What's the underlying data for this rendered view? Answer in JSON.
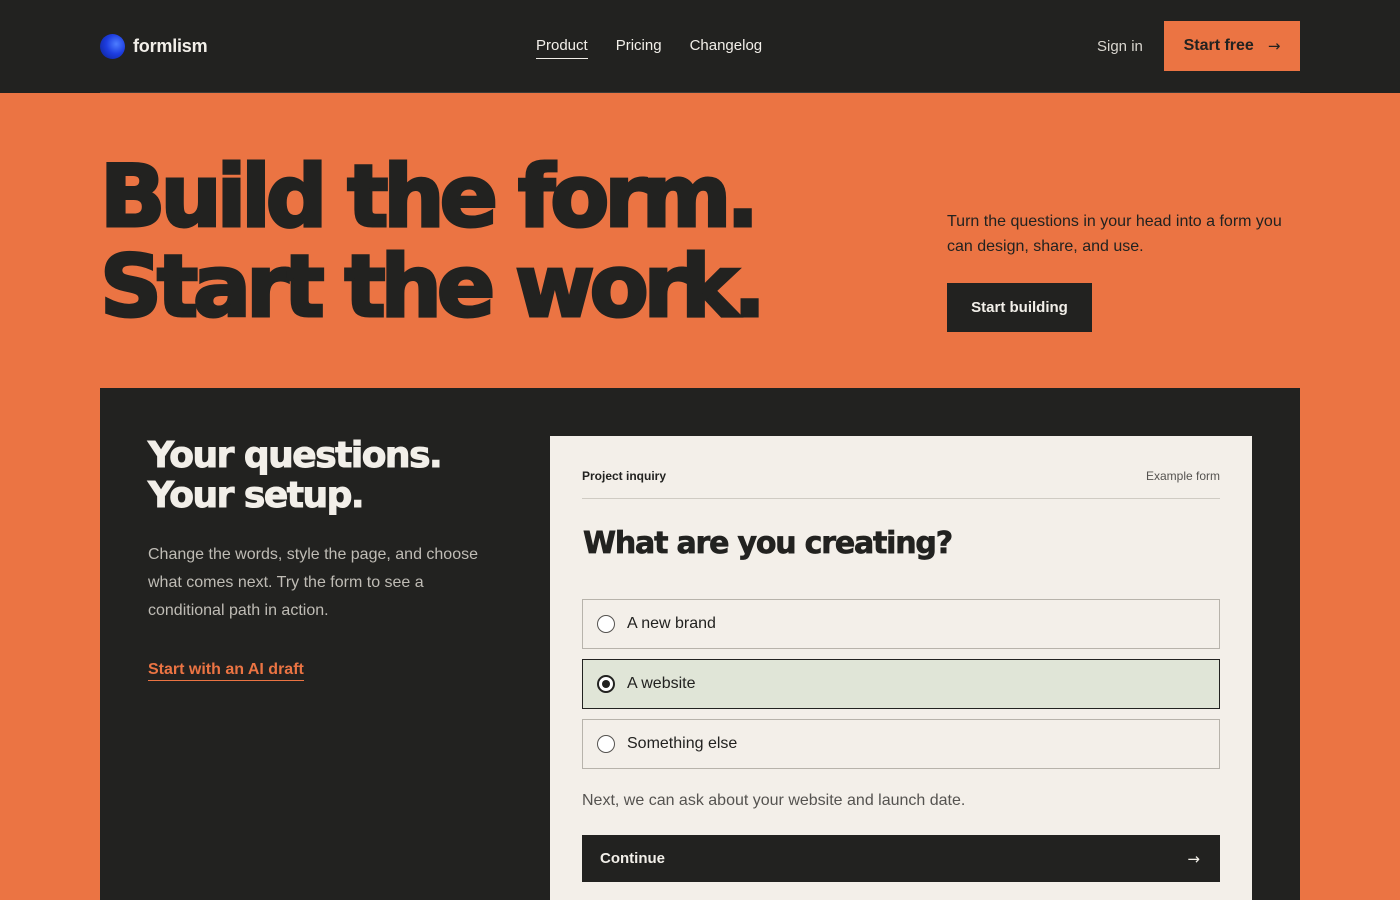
{
  "brand": {
    "name": "formlism",
    "logo_icon": "blue-sphere-logo"
  },
  "nav": {
    "links": [
      {
        "label": "Product",
        "active": true
      },
      {
        "label": "Pricing",
        "active": false
      },
      {
        "label": "Changelog",
        "active": false
      }
    ],
    "sign_in": "Sign in",
    "start_free": "Start free",
    "start_free_icon": "arrow-right-icon"
  },
  "hero": {
    "title_line1": "Build the form.",
    "title_line2": "Start the work.",
    "subtitle": "Turn the questions in your head into a form you can design, share, and use.",
    "cta": "Start building"
  },
  "section": {
    "title_line1": "Your questions.",
    "title_line2": "Your setup.",
    "description": "Change the words, style the page, and choose what comes next. Try the form to see a conditional path in action.",
    "link": "Start with an AI draft"
  },
  "form": {
    "label": "Project inquiry",
    "tag": "Example form",
    "question": "What are you creating?",
    "options": [
      {
        "label": "A new brand",
        "selected": false
      },
      {
        "label": "A website",
        "selected": true
      },
      {
        "label": "Something else",
        "selected": false
      }
    ],
    "hint": "Next, we can ask about your website and launch date.",
    "continue": "Continue"
  },
  "colors": {
    "accent": "#eb7443",
    "dark": "#222220",
    "card": "#f3efe9",
    "selected": "#e0e5d7"
  }
}
